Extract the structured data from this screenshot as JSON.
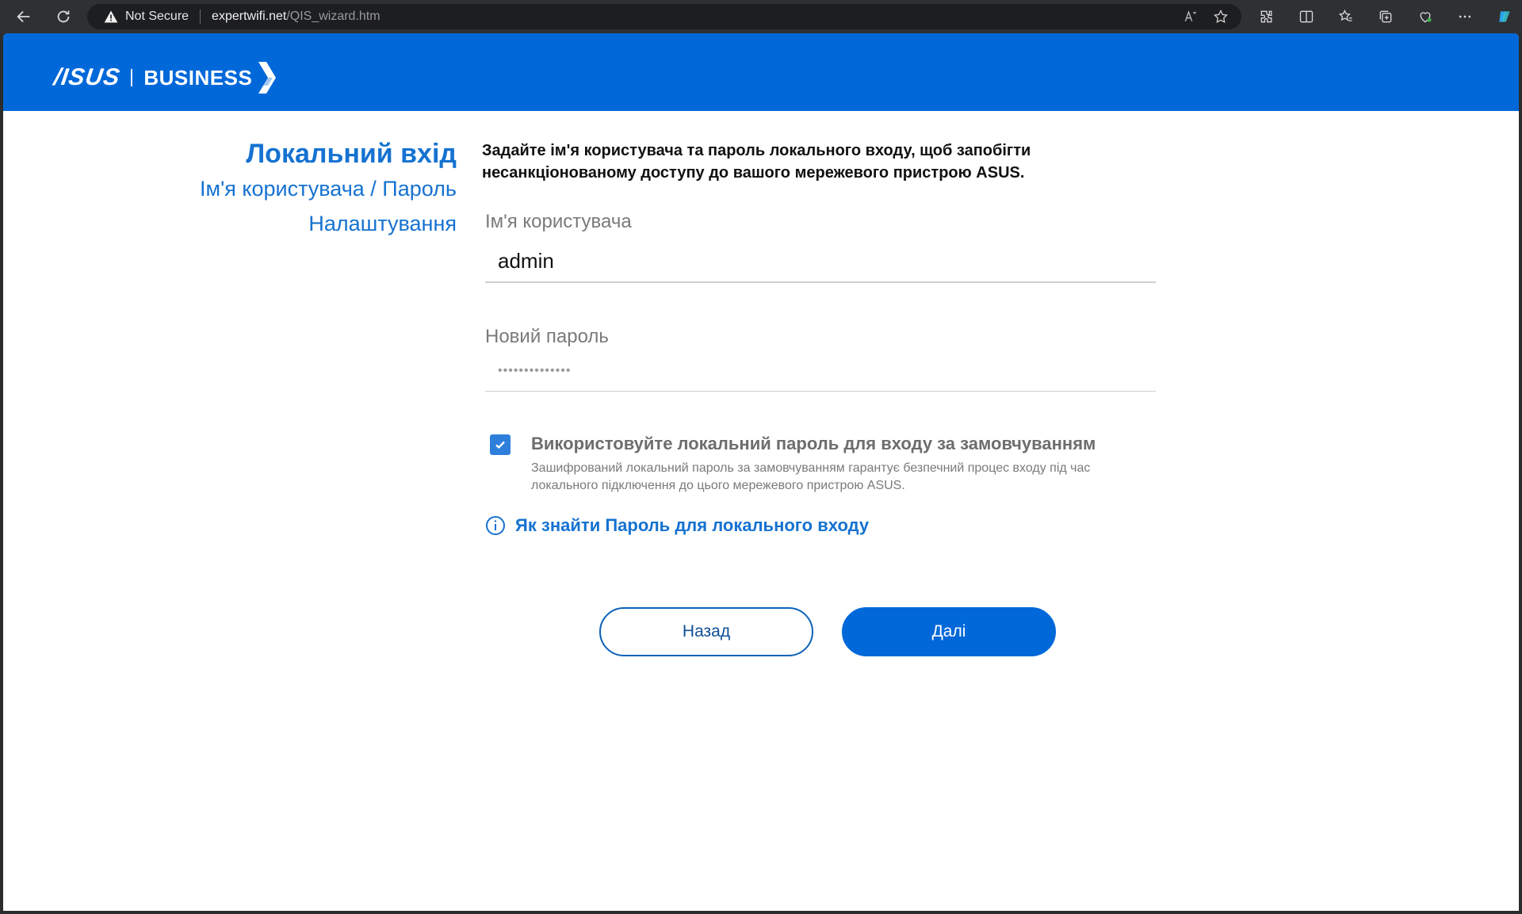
{
  "browser": {
    "security_label": "Not Secure",
    "url_host": "expertwifi.net",
    "url_path": "/QIS_wizard.htm"
  },
  "header": {
    "logo_text": "/ISUS",
    "brand_text": "BUSINESS"
  },
  "sidebar": {
    "title": "Локальний вхід",
    "subtitle_line1": "Ім'я користувача / Пароль",
    "subtitle_line2": "Налаштування"
  },
  "form": {
    "intro_line1": "Задайте ім'я користувача та пароль локального входу, щоб запобігти",
    "intro_line2": "несанкціонованому доступу до вашого мережевого пристрою ASUS.",
    "username": {
      "label": "Ім'я користувача",
      "value": "admin"
    },
    "password": {
      "label": "Новий пароль",
      "value": "••••••••••••••"
    },
    "checkbox": {
      "checked": true,
      "title": "Використовуйте локальний пароль для входу за замовчуванням",
      "desc_line1": "Зашифрований локальний пароль за замовчуванням гарантує безпечний процес входу під час",
      "desc_line2": "локального підключення до цього мережевого пристрою ASUS."
    },
    "help_link": "Як знайти Пароль для локального входу"
  },
  "buttons": {
    "back": "Назад",
    "next": "Далі"
  },
  "colors": {
    "brand_blue": "#0068d9",
    "link_blue": "#1572d1",
    "checkbox_blue": "#2e7fdb"
  }
}
